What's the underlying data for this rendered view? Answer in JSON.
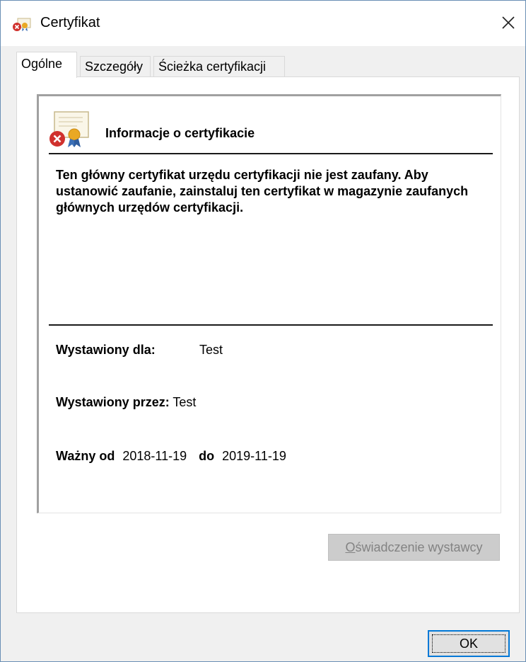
{
  "window": {
    "title": "Certyfikat",
    "close_symbol": "✕"
  },
  "tabs": [
    {
      "label": "Ogólne",
      "active": true
    },
    {
      "label": "Szczegóły",
      "active": false
    },
    {
      "label": "Ścieżka certyfikacji",
      "active": false
    }
  ],
  "info": {
    "heading": "Informacje o certyfikacie",
    "warning": "Ten główny certyfikat urzędu certyfikacji nie jest zaufany. Aby ustanowić zaufanie, zainstaluj ten certyfikat w magazynie zaufanych głównych urzędów certyfikacji.",
    "issued_to_label": "Wystawiony dla:",
    "issued_to_value": "Test",
    "issued_by_label": "Wystawiony przez:",
    "issued_by_value": "Test",
    "valid_from_label": "Ważny od",
    "valid_from_value": "2018-11-19",
    "valid_to_label": "do",
    "valid_to_value": "2019-11-19"
  },
  "buttons": {
    "issuer_statement_first": "O",
    "issuer_statement_rest": "świadczenie wystawcy",
    "issuer_statement_enabled": false,
    "ok": "OK"
  },
  "icons": {
    "title_icon": "certificate-error-icon",
    "cert_icon": "certificate-error-icon",
    "close": "close-icon"
  },
  "colors": {
    "window_border": "#6a8fb5",
    "error_red": "#d0312d",
    "focus_blue": "#0078d7"
  }
}
